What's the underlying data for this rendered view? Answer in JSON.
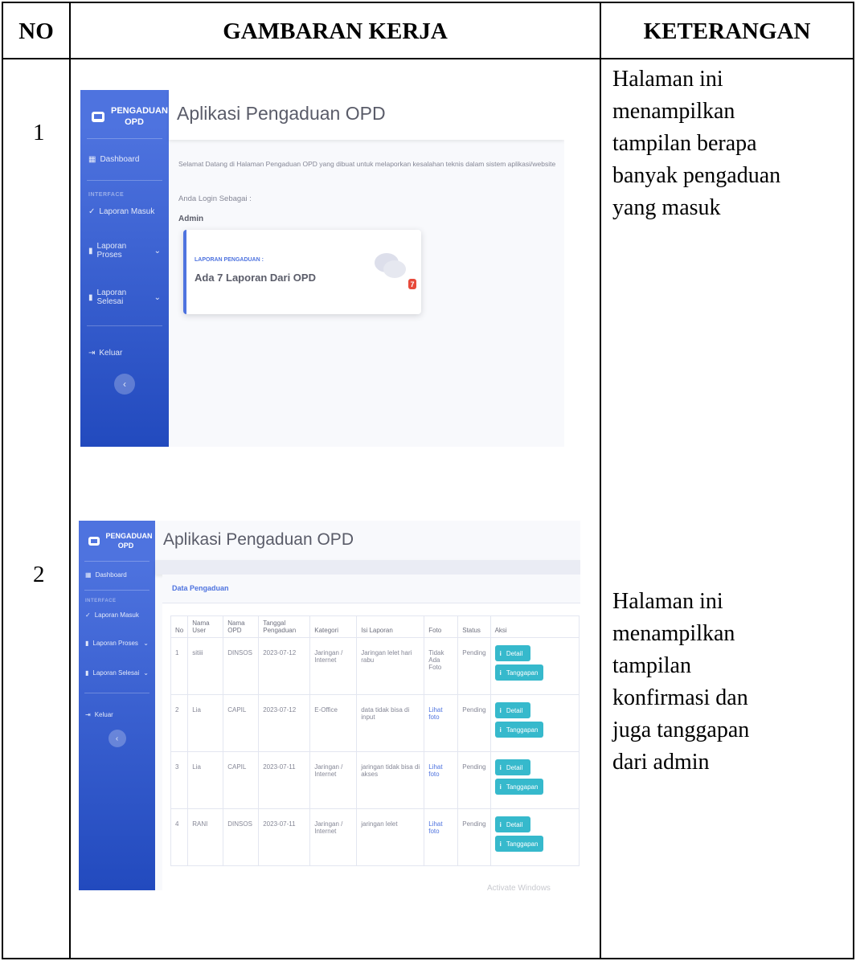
{
  "table": {
    "headers": {
      "no": "NO",
      "gambaran": "GAMBARAN KERJA",
      "keterangan": "KETERANGAN"
    },
    "rows": [
      {
        "no": "1",
        "keterangan": [
          "Halaman ini",
          "menampilkan",
          "tampilan berapa",
          "banyak pengaduan",
          "yang masuk"
        ]
      },
      {
        "no": "2",
        "keterangan": [
          "Halaman ini",
          "menampilkan",
          "tampilan",
          "konfirmasi dan",
          "juga tanggapan",
          "dari admin"
        ]
      }
    ]
  },
  "app": {
    "brand": "PENGADUAN OPD",
    "title": "Aplikasi Pengaduan OPD",
    "sidebar": {
      "dashboard": "Dashboard",
      "heading": "INTERFACE",
      "items": [
        "Laporan Masuk",
        "Laporan Proses",
        "Laporan Selesai"
      ],
      "logout": "Keluar",
      "toggle": "‹"
    }
  },
  "shot1": {
    "welcome": "Selamat Datang di Halaman Pengaduan OPD yang dibuat untuk melaporkan kesalahan teknis dalam sistem aplikasi/website",
    "login_label": "Anda Login Sebagai :",
    "login_user": "Admin",
    "card_label": "LAPORAN PENGADUAN :",
    "card_value": "Ada 7 Laporan Dari OPD",
    "badge": "7"
  },
  "shot2": {
    "card_title": "Data Pengaduan",
    "columns": [
      "No",
      "Nama User",
      "Nama OPD",
      "Tanggal Pengaduan",
      "Kategori",
      "Isi Laporan",
      "Foto",
      "Status",
      "Aksi"
    ],
    "rows": [
      {
        "no": "1",
        "user": "sitiii",
        "opd": "DINSOS",
        "tanggal": "2023-07-12",
        "kategori": "Jaringan / Internet",
        "isi": "Jaringan lelet hari rabu",
        "foto": "Tidak Ada Foto",
        "status": "Pending"
      },
      {
        "no": "2",
        "user": "Lia",
        "opd": "CAPIL",
        "tanggal": "2023-07-12",
        "kategori": "E-Office",
        "isi": "data tidak bisa di input",
        "foto": "Lihat foto",
        "status": "Pending"
      },
      {
        "no": "3",
        "user": "Lia",
        "opd": "CAPIL",
        "tanggal": "2023-07-11",
        "kategori": "Jaringan / Internet",
        "isi": "jaringan tidak bisa di akses",
        "foto": "Lihat foto",
        "status": "Pending"
      },
      {
        "no": "4",
        "user": "RANI",
        "opd": "DINSOS",
        "tanggal": "2023-07-11",
        "kategori": "Jaringan / Internet",
        "isi": "jaringan lelet",
        "foto": "Lihat foto",
        "status": "Pending"
      }
    ],
    "btn_detail": "Detail",
    "btn_tanggapan": "Tanggapan",
    "watermark": "Activate Windows"
  }
}
